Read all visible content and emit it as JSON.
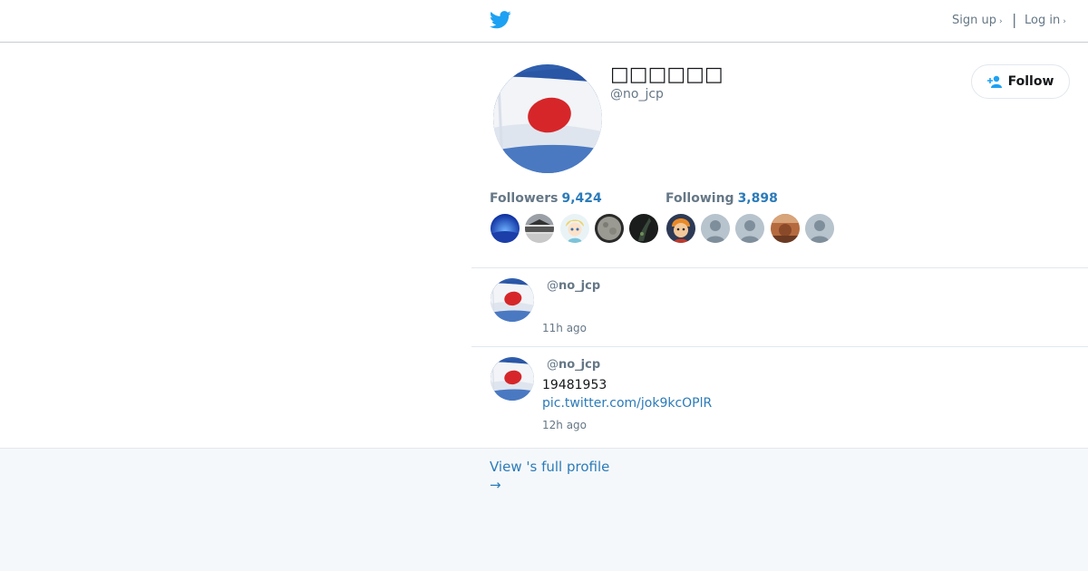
{
  "header": {
    "logo_icon": "twitter-bird-icon",
    "signup_label": "Sign up",
    "login_label": "Log in",
    "separator": "|",
    "chevron": "›"
  },
  "profile": {
    "name": "□□□□□□",
    "handle": "@no_jcp",
    "avatar": "japan-flag-avatar",
    "follow_label": "Follow",
    "followers_label": "Followers",
    "followers_count": "9,424",
    "following_label": "Following",
    "following_count": "3,898"
  },
  "follower_avatars": [
    "blue-sky-avatar",
    "landscape-avatar",
    "anime-character-avatar",
    "moon-avatar",
    "dark-avatar"
  ],
  "following_avatars": [
    "cartoon-boy-avatar",
    "default-avatar",
    "default-avatar",
    "photo-avatar",
    "default-avatar"
  ],
  "tweets": [
    {
      "handle_prefix": "@",
      "handle": "no_jcp",
      "text": "",
      "link": "",
      "time": "11h ago"
    },
    {
      "handle_prefix": "@",
      "handle": "no_jcp",
      "text": "19481953",
      "link": "pic.twitter.com/jok9kcOPlR",
      "time": "12h ago"
    }
  ],
  "footer": {
    "view_profile_label": "View 's full profile",
    "arrow": "→"
  },
  "colors": {
    "accent": "#2b7bb9",
    "muted": "#657786",
    "twitter_blue": "#1da1f2",
    "footer_bg": "#f5f8fa"
  }
}
